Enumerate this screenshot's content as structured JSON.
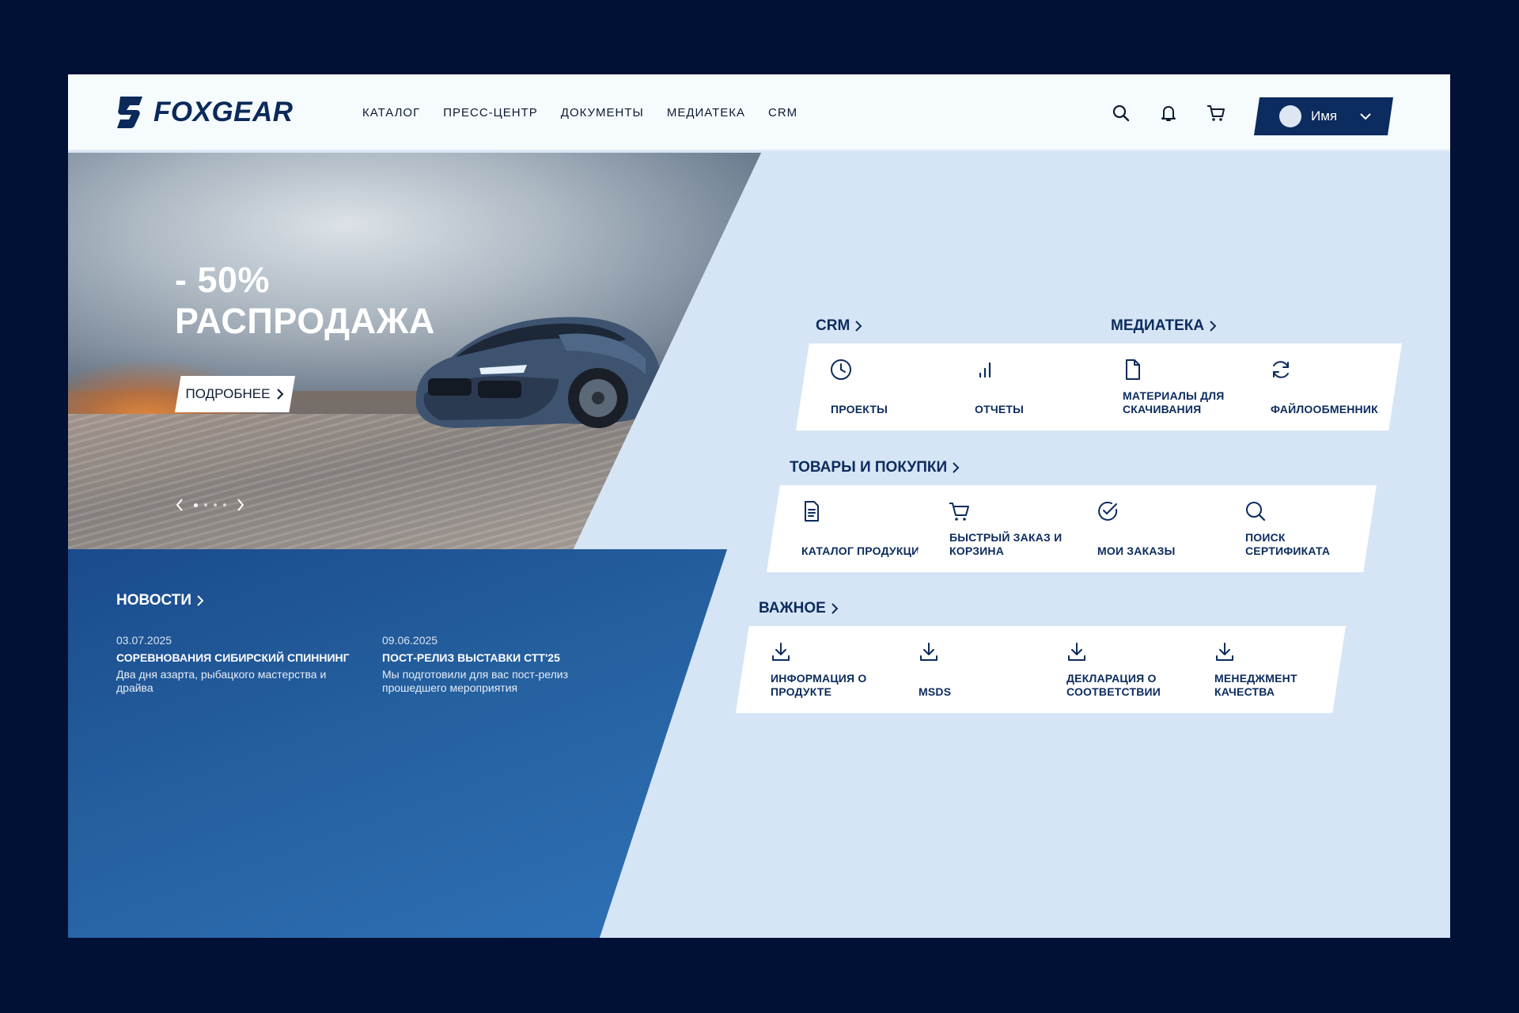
{
  "header": {
    "logo_text": "FOXGEAR",
    "nav": [
      "КАТАЛОГ",
      "ПРЕСС-ЦЕНТР",
      "ДОКУМЕНТЫ",
      "МЕДИАТЕКА",
      "CRM"
    ],
    "user_name": "Имя"
  },
  "hero": {
    "sale_line1": "- 50%",
    "sale_line2": "РАСПРОДАЖА",
    "button": "ПОДРОБНЕЕ",
    "slides_count": 4,
    "active_slide": 1
  },
  "news": {
    "title": "НОВОСТИ",
    "items": [
      {
        "date": "03.07.2025",
        "title": "СОРЕВНОВАНИЯ СИБИРСКИЙ СПИННИНГ",
        "text": "Два дня азарта, рыбацкого мастерства и драйва"
      },
      {
        "date": "09.06.2025",
        "title": "ПОСТ-РЕЛИЗ ВЫСТАВКИ СТТ'25",
        "text": "Мы подготовили для вас пост-релиз прошедшего мероприятия"
      }
    ]
  },
  "sections": {
    "crm": {
      "title": "CRM",
      "tiles": [
        {
          "label": "ПРОЕКТЫ",
          "icon": "clock-icon"
        },
        {
          "label": "ОТЧЕТЫ",
          "icon": "bar-chart-icon"
        }
      ]
    },
    "media": {
      "title": "МЕДИАТЕКА",
      "tiles": [
        {
          "label": "МАТЕРИАЛЫ ДЛЯ СКАЧИВАНИЯ",
          "icon": "file-icon"
        },
        {
          "label": "ФАЙЛООБМЕННИК",
          "icon": "refresh-icon"
        }
      ]
    },
    "goods": {
      "title": "ТОВАРЫ И ПОКУПКИ",
      "tiles": [
        {
          "label": "КАТАЛОГ ПРОДУКЦИИ",
          "icon": "document-icon"
        },
        {
          "label": "БЫСТРЫЙ ЗАКАЗ И КОРЗИНА",
          "icon": "cart-icon"
        },
        {
          "label": "МОИ ЗАКАЗЫ",
          "icon": "check-circle-icon"
        },
        {
          "label": "ПОИСК СЕРТИФИКАТА",
          "icon": "search-icon"
        }
      ]
    },
    "important": {
      "title": "ВАЖНОЕ",
      "tiles": [
        {
          "label": "ИНФОРМАЦИЯ О ПРОДУКТЕ",
          "icon": "download-icon"
        },
        {
          "label": "MSDS",
          "icon": "download-icon"
        },
        {
          "label": "ДЕКЛАРАЦИЯ О СООТВЕТСТВИИ",
          "icon": "download-icon"
        },
        {
          "label": "МЕНЕДЖМЕНТ КАЧЕСТВА",
          "icon": "download-icon"
        }
      ]
    }
  },
  "colors": {
    "page_background": "#011035",
    "brand_navy": "#0c2b5e",
    "panel_light_blue": "#d6e5f5",
    "news_blue": "#25609f",
    "header_background": "#f6fbfe"
  }
}
